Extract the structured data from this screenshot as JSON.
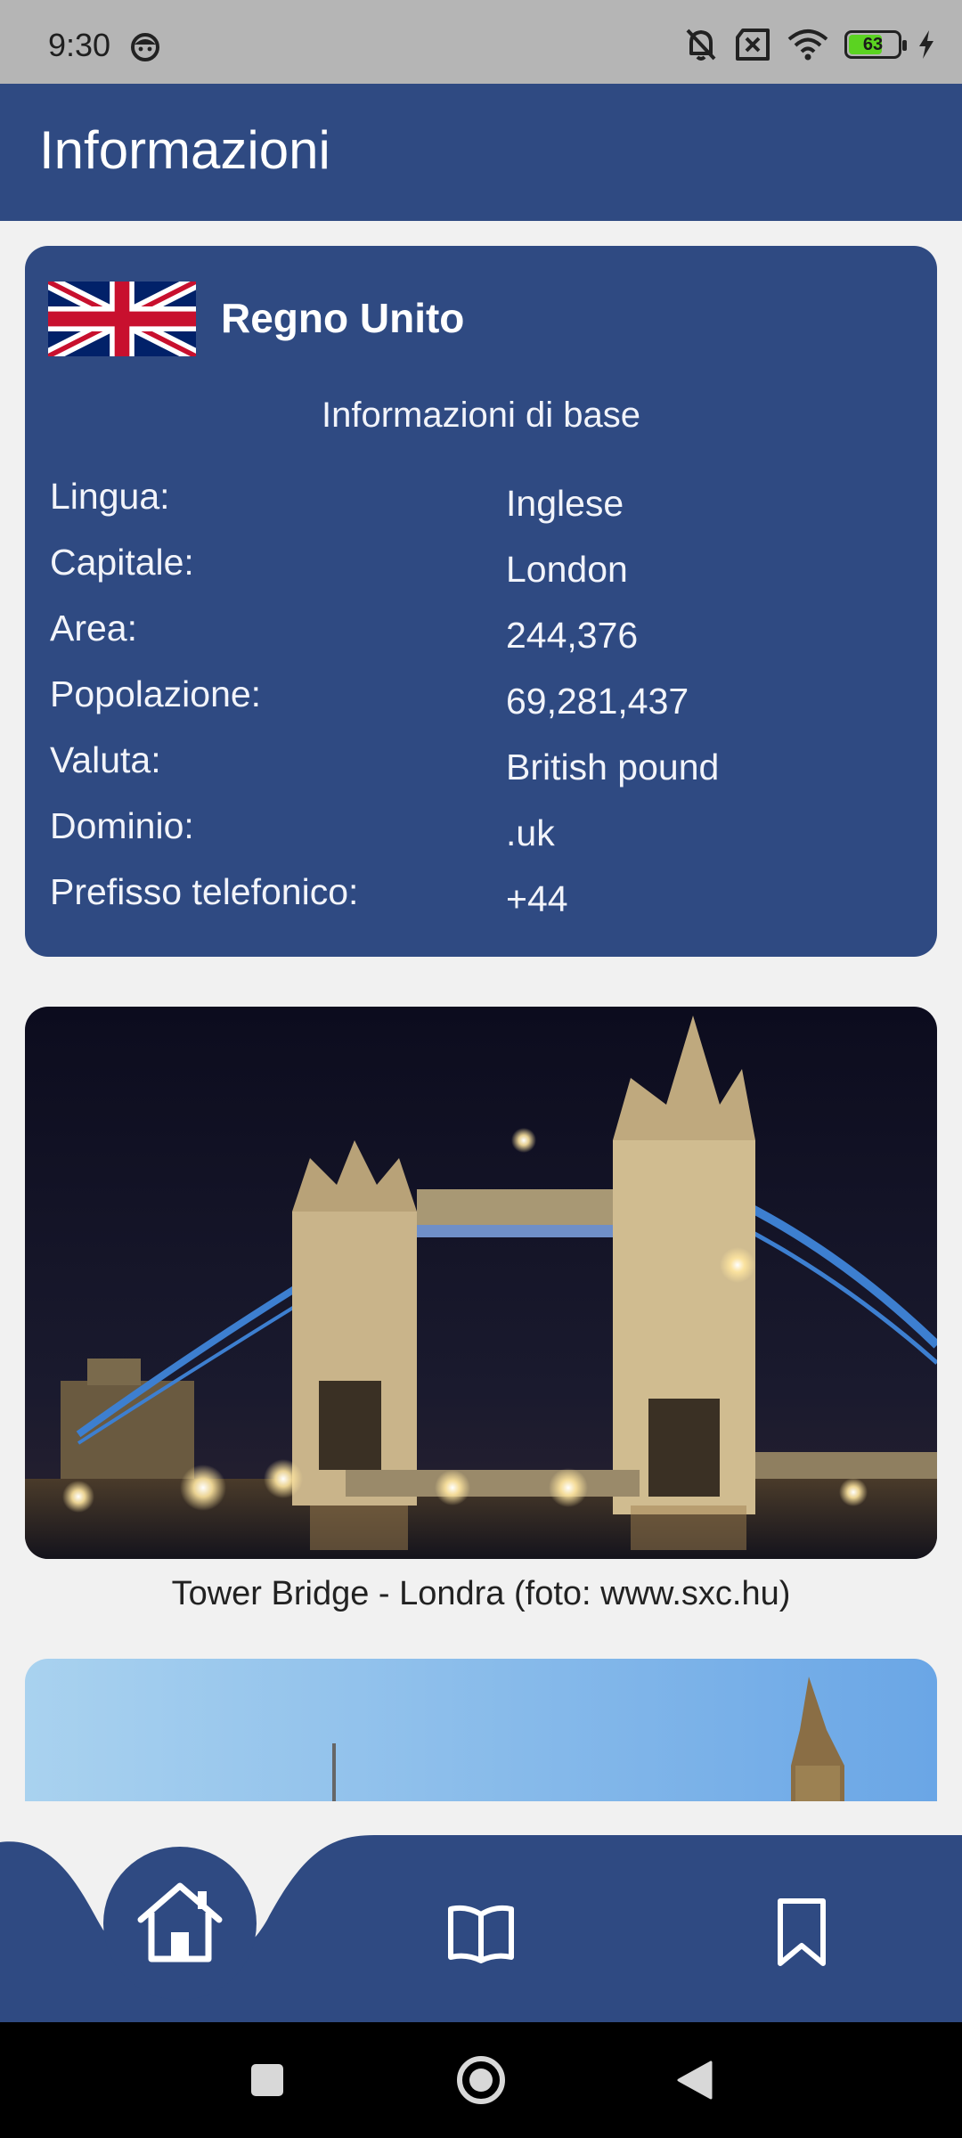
{
  "status_bar": {
    "time": "9:30",
    "battery_percent": "63",
    "icons": [
      "face-icon",
      "bell-off-icon",
      "sim-off-icon",
      "wifi-icon",
      "battery-icon",
      "charging-bolt-icon"
    ]
  },
  "app_bar": {
    "title": "Informazioni"
  },
  "country": {
    "name": "Regno Unito",
    "flag_icon": "uk-flag-icon",
    "section_title": "Informazioni di base",
    "rows": [
      {
        "label": "Lingua:",
        "value": "Inglese"
      },
      {
        "label": "Capitale:",
        "value": "London"
      },
      {
        "label": "Area:",
        "value": "244,376"
      },
      {
        "label": "Popolazione:",
        "value": "69,281,437"
      },
      {
        "label": "Valuta:",
        "value": "British pound"
      },
      {
        "label": "Dominio:",
        "value": ".uk"
      },
      {
        "label": "Prefisso telefonico:",
        "value": "+44"
      }
    ]
  },
  "gallery": {
    "photo1_caption": "Tower Bridge - Londra (foto: www.sxc.hu)"
  },
  "bottom_nav": {
    "items": [
      {
        "icon": "home-icon",
        "active": true
      },
      {
        "icon": "book-icon",
        "active": false
      },
      {
        "icon": "bookmark-icon",
        "active": false
      }
    ]
  },
  "colors": {
    "primary": "#2f4a82",
    "background": "#f1f1f1",
    "status_bar": "#b5b5b5"
  }
}
